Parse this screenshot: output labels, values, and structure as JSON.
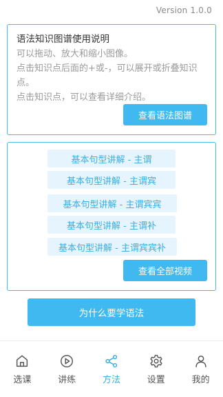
{
  "version": "Version 1.0.0",
  "guide": {
    "title": "语法知识图谱使用说明",
    "lines": [
      "可以拖动、放大和缩小图像。",
      "点击知识点后面的+或-，可以展开或折叠知识点。",
      "点击知识点，可以查看详细介绍。"
    ],
    "button": "查看语法图谱"
  },
  "lessons": {
    "items": [
      "基本句型讲解 - 主谓",
      "基本句型讲解 - 主谓宾",
      "基本句型讲解 - 主谓宾宾",
      "基本句型讲解 - 主谓补",
      "基本句型讲解 - 主谓宾宾补"
    ],
    "button": "查看全部视频"
  },
  "main_button": "为什么要学语法",
  "tabs": [
    {
      "label": "选课",
      "icon": "home-icon"
    },
    {
      "label": "讲练",
      "icon": "play-icon"
    },
    {
      "label": "方法",
      "icon": "share-icon",
      "active": true
    },
    {
      "label": "设置",
      "icon": "gear-icon"
    },
    {
      "label": "我的",
      "icon": "person-icon"
    }
  ],
  "colors": {
    "accent": "#40b8f0",
    "lesson_bg": "#e6f5fd",
    "inactive_icon": "#555555"
  }
}
